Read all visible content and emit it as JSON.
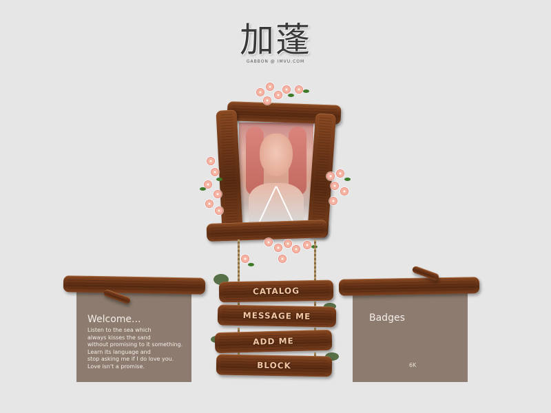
{
  "header": {
    "title": "加蓬",
    "subtitle": "GABBON @ IMVU.COM"
  },
  "signs": [
    {
      "label": "CATALOG"
    },
    {
      "label": "MESSAGE ME"
    },
    {
      "label": "ADD ME"
    },
    {
      "label": "BLOCK"
    }
  ],
  "welcome": {
    "heading": "Welcome...",
    "body": "Listen to the sea which\nalways kisses the sand\nwithout promising to it something.\nLearn its language and\nstop asking me if I do love you.\nLove isn't a promise."
  },
  "badges": {
    "heading": "Badges",
    "count": "6K"
  },
  "colors": {
    "background": "#e6e6e6",
    "panel": "#8c7b6e",
    "wood": "#6b3518",
    "sign_text": "#f1c7a4",
    "flower": "#f6b3a3"
  },
  "icons": {
    "frame": "wooden-photo-frame",
    "flowers": "cherry-blossom-decoration"
  }
}
